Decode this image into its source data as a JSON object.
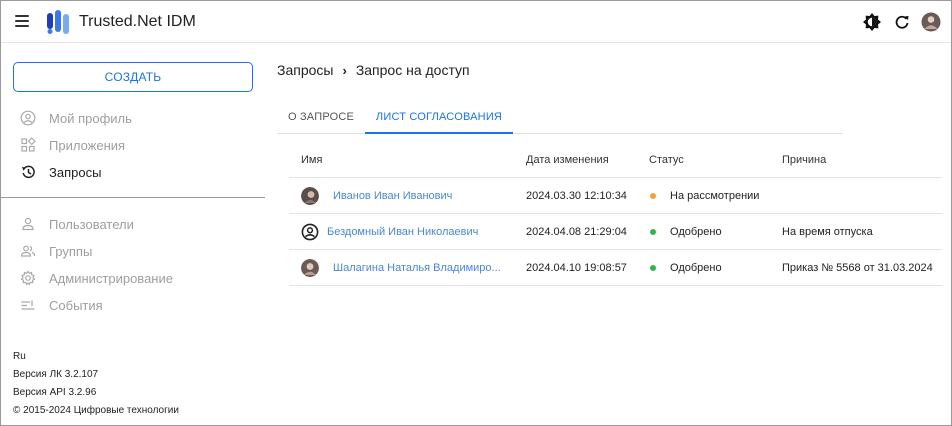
{
  "app": {
    "title": "Trusted.Net IDM",
    "logo_colors": [
      "#1e3cbe",
      "#3c78e6",
      "#78aaf0"
    ]
  },
  "topbar": {
    "icons": [
      "brightness-icon",
      "refresh-icon",
      "user-avatar"
    ]
  },
  "sidebar": {
    "create_label": "СОЗДАТЬ",
    "items_top": [
      {
        "label": "Мой профиль",
        "icon": "account-circle-icon",
        "active": false
      },
      {
        "label": "Приложения",
        "icon": "apps-grid-icon",
        "active": false
      },
      {
        "label": "Запросы",
        "icon": "history-icon",
        "active": true
      }
    ],
    "items_bottom": [
      {
        "label": "Пользователи",
        "icon": "person-icon"
      },
      {
        "label": "Группы",
        "icon": "group-icon"
      },
      {
        "label": "Администрирование",
        "icon": "gear-icon"
      },
      {
        "label": "События",
        "icon": "events-list-icon"
      }
    ],
    "footer": {
      "lang": "Ru",
      "lk_version": "Версия ЛК 3.2.107",
      "api_version": "Версия API 3.2.96",
      "copyright": "© 2015-2024 Цифровые технологии"
    }
  },
  "breadcrumb": {
    "parent": "Запросы",
    "separator": "›",
    "current": "Запрос на доступ"
  },
  "tabs": {
    "info": "О ЗАПРОСЕ",
    "sheet": "ЛИСТ СОГЛАСОВАНИЯ",
    "active": "sheet"
  },
  "table": {
    "headers": {
      "name": "Имя",
      "date": "Дата изменения",
      "status": "Статус",
      "reason": "Причина"
    },
    "rows": [
      {
        "name": "Иванов Иван Иванович",
        "date": "2024.03.30 12:10:34",
        "status": "На рассмотрении",
        "status_color": "#f5a033",
        "reason": "",
        "avatar": "photo"
      },
      {
        "name": "Бездомный Иван Николаевич",
        "date": "2024.04.08 21:29:04",
        "status": "Одобрено",
        "status_color": "#2eb84b",
        "reason": "На время отпуска",
        "avatar": "default"
      },
      {
        "name": "Шалагина Наталья Владимиро...",
        "date": "2024.04.10 19:08:57",
        "status": "Одобрено",
        "status_color": "#2eb84b",
        "reason": "Приказ № 5568 от 31.03.2024",
        "avatar": "photo"
      }
    ]
  },
  "colors": {
    "accent": "#1a73e8",
    "link": "#4a86d9",
    "muted": "#9e9e9e"
  }
}
